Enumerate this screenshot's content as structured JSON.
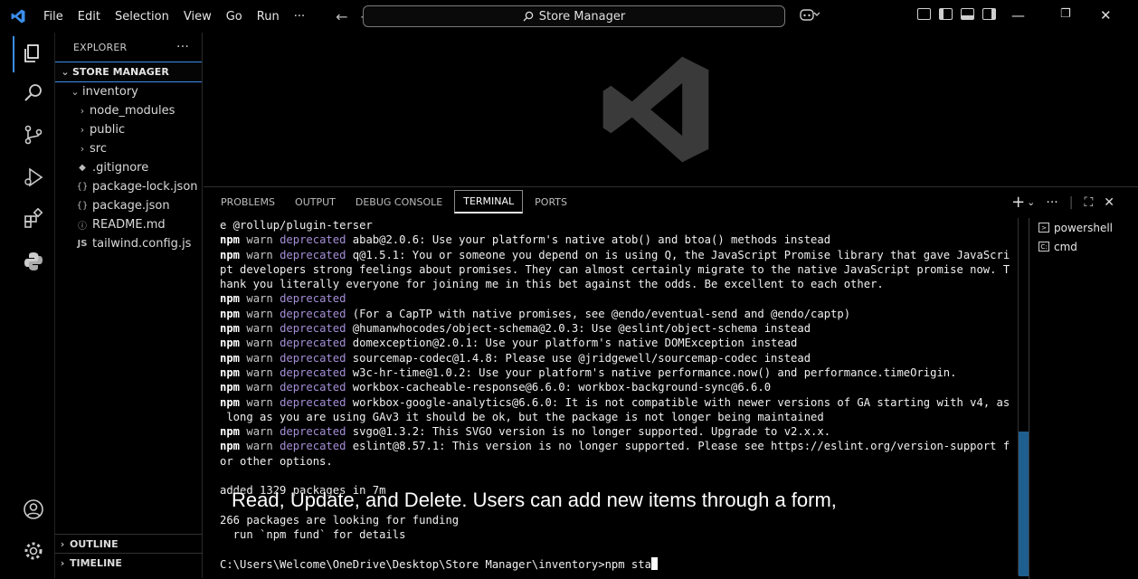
{
  "menu": [
    "File",
    "Edit",
    "Selection",
    "View",
    "Go",
    "Run",
    "···"
  ],
  "command_center": "Store Manager",
  "sidebar": {
    "title": "EXPLORER",
    "more": "···",
    "root": "STORE MANAGER",
    "tree": [
      {
        "label": "inventory",
        "icon": "chevron-down"
      },
      {
        "label": "node_modules",
        "icon": "chevron-right"
      },
      {
        "label": "public",
        "icon": "chevron-right"
      },
      {
        "label": "src",
        "icon": "chevron-right"
      },
      {
        "label": ".gitignore",
        "icon": "git"
      },
      {
        "label": "package-lock.json",
        "icon": "{}"
      },
      {
        "label": "package.json",
        "icon": "{}"
      },
      {
        "label": "README.md",
        "icon": "info"
      },
      {
        "label": "tailwind.config.js",
        "icon": "JS"
      }
    ],
    "outline": "OUTLINE",
    "timeline": "TIMELINE"
  },
  "panel": {
    "tabs": [
      "PROBLEMS",
      "OUTPUT",
      "DEBUG CONSOLE",
      "TERMINAL",
      "PORTS"
    ],
    "active_tab": "TERMINAL"
  },
  "terminals": [
    "powershell",
    "cmd"
  ],
  "terminal": {
    "line0": "e @rollup/plugin-terser",
    "warn_prefix": [
      "npm",
      "warn",
      "deprecated"
    ],
    "l1": " abab@2.0.6: Use your platform's native atob() and btoa() methods instead",
    "l2": " q@1.5.1: You or someone you depend on is using Q, the JavaScript Promise library that gave JavaScri",
    "l3": "pt developers strong feelings about promises. They can almost certainly migrate to the native JavaScript promise now. T",
    "l4": "hank you literally everyone for joining me in this bet against the odds. Be excellent to each other.",
    "l5": "",
    "l6": " (For a CapTP with native promises, see @endo/eventual-send and @endo/captp)",
    "l7": " @humanwhocodes/object-schema@2.0.3: Use @eslint/object-schema instead",
    "l8": " domexception@2.0.1: Use your platform's native DOMException instead",
    "l9": " sourcemap-codec@1.4.8: Please use @jridgewell/sourcemap-codec instead",
    "l10": " w3c-hr-time@1.0.2: Use your platform's native performance.now() and performance.timeOrigin.",
    "l11": " workbox-cacheable-response@6.6.0: workbox-background-sync@6.6.0",
    "l12": " workbox-google-analytics@6.6.0: It is not compatible with newer versions of GA starting with v4, as",
    "l13": " long as you are using GAv3 it should be ok, but the package is not longer being maintained",
    "l14": " svgo@1.3.2: This SVGO version is no longer supported. Upgrade to v2.x.x.",
    "l15": " eslint@8.57.1: This version is no longer supported. Please see https://eslint.org/version-support f",
    "l16": "or other options.",
    "l17": "",
    "l18": "added 1329 packages in 7m",
    "l19": "",
    "l20": "266 packages are looking for funding",
    "l21": "  run `npm fund` for details",
    "l22": "",
    "prompt": "C:\\Users\\Welcome\\OneDrive\\Desktop\\Store Manager\\inventory>npm sta"
  },
  "caption": "Read, Update, and Delete. Users can add new items through a form,",
  "colors": {
    "accent": "#3b8eea",
    "deprecated": "#a58fd8",
    "scrollbar": "#1f5f8f"
  }
}
